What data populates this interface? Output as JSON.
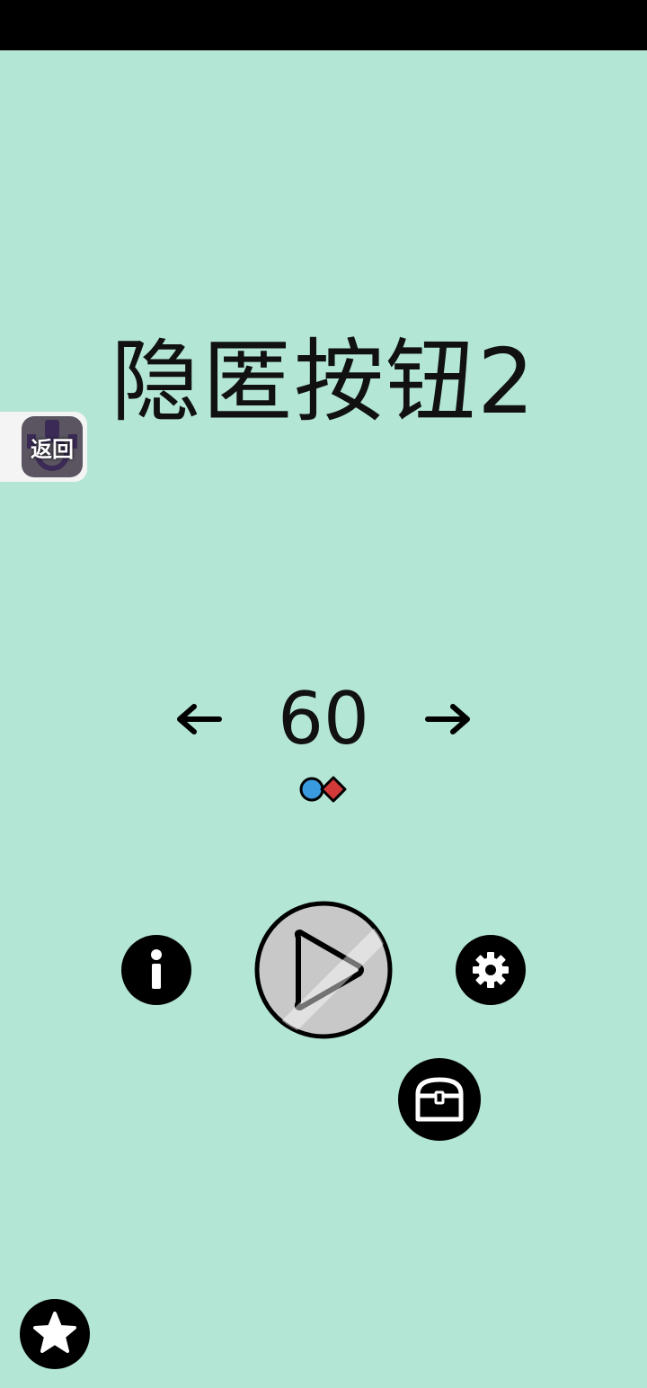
{
  "title": "隐匿按钮2",
  "back_button": {
    "label": "返回"
  },
  "level_selector": {
    "value": "60"
  },
  "gems": {
    "blue": "#3a9ae0",
    "red": "#d23a3a"
  },
  "colors": {
    "background": "#b3e6d5",
    "foreground": "#000000",
    "play_disabled": "#c8c8c8"
  },
  "buttons": {
    "info": "info-icon",
    "play": "play-icon",
    "settings": "gear-icon",
    "chest": "treasure-chest-icon",
    "star": "star-icon"
  }
}
